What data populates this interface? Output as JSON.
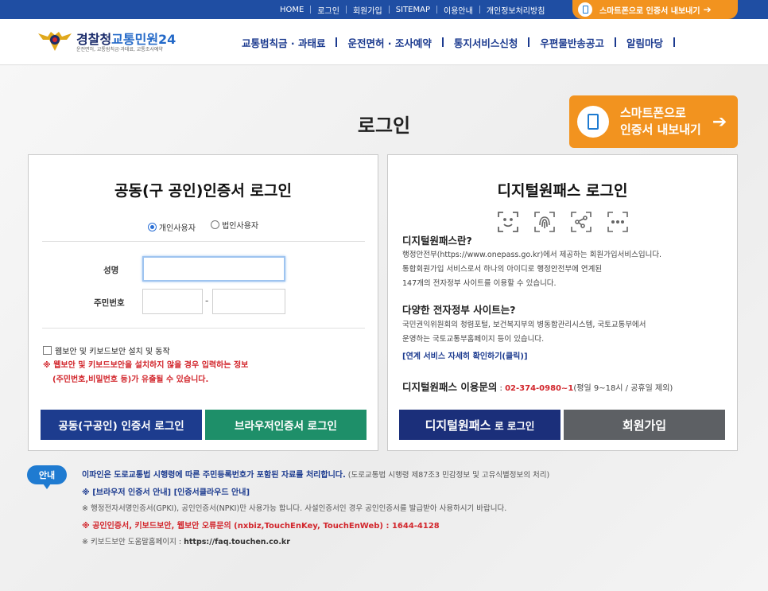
{
  "topbar": {
    "links": [
      "HOME",
      "로그인",
      "회원가입",
      "SITEMAP",
      "이용안내",
      "개인정보처리방침"
    ],
    "export_label": "스마트폰으로 인증서 내보내기",
    "colors": {
      "bar": "#1f4ea3",
      "export": "#f2931f"
    }
  },
  "header": {
    "logo_main_a": "경찰청",
    "logo_main_b": "교통민원24",
    "logo_sub": "운전면허, 교통범칙금·과태료, 교통조사예약",
    "nav": [
      "교통범칙금 · 과태료",
      "운전면허 · 조사예약",
      "통지서비스신청",
      "우편물반송공고",
      "알림마당"
    ]
  },
  "page_title": "로그인",
  "big_export": {
    "line1": "스마트폰으로",
    "line2": "인증서 내보내기"
  },
  "cert_login": {
    "title": "공동(구 공인)인증서 로그인",
    "user_types": [
      {
        "label": "개인사용자",
        "selected": true
      },
      {
        "label": "법인사용자",
        "selected": false
      }
    ],
    "name_label": "성명",
    "name_value": "",
    "rrn_label": "주민번호",
    "rrn_sep": "-",
    "security_check_label": "웹보안 및 키보드보안 설치 및 동작",
    "warning_line1": "※ 웹보안 및 키보드보안을 설치하지 않을 경우 입력하는 정보",
    "warning_line2": "(주민번호,비밀번호 등)가 유출될 수 있습니다.",
    "btn_cert": "공동(구공인) 인증서 로그인",
    "btn_browser": "브라우저인증서 로그인"
  },
  "onepass": {
    "title": "디지털원패스 로그인",
    "icons": [
      "face-id-icon",
      "fingerprint-icon",
      "pattern-icon",
      "pin-icon"
    ],
    "q1": "디지털원패스란?",
    "a1": [
      "행정안전부(https://www.onepass.go.kr)에서 제공하는 회원가입서비스입니다.",
      "통합회원가입 서비스로서 하나의 아이디로 행정안전부에 연계된",
      "147개의 전자정부 사이트를 이용할 수 있습니다."
    ],
    "q2": "다양한 전자정부 사이트는?",
    "a2": [
      "국민권익위원회의 청렴포털, 보건복지부의 병동합관리시스템, 국토교통부에서",
      "운영하는 국토교통부홈페이지 등이 있습니다."
    ],
    "link": "[연계 서비스 자세히 확인하기(클릭)]",
    "contact_label": "디지털원패스 이용문의",
    "contact_colon": " : ",
    "contact_number": "02-374-0980~1",
    "contact_hours": "(평일 9~18시 / 공휴일 제외)",
    "btn_login_bold": "디지털원패스",
    "btn_login_rest": "로 로그인",
    "btn_join": "회원가입"
  },
  "notice": {
    "badge": "안내",
    "line1_bold": "이파인은 도로교통법 시행령에 따른 주민등록번호가 포함된 자료를 처리합니다.",
    "line1_rest": " (도로교통법 시행령 제87조3 민감정보 및 고유식별정보의 처리)",
    "line2": "※ [브라우저 인증서 안내] [인증서클라우드 안내]",
    "line3": "※ 행정전자서명인증서(GPKI), 공인인증서(NPKI)만 사용가능 합니다. 사설인증서인 경우 공인인증서를 발급받아 사용하시기 바랍니다.",
    "line4": "※ 공인인증서, 키보드보안, 웹보안 오류문의 (nxbiz,TouchEnKey, TouchEnWeb) : 1644-4128",
    "line5_pre": "※ 키보드보안 도움말홈페이지 : ",
    "line5_link": "https://faq.touchen.co.kr"
  }
}
